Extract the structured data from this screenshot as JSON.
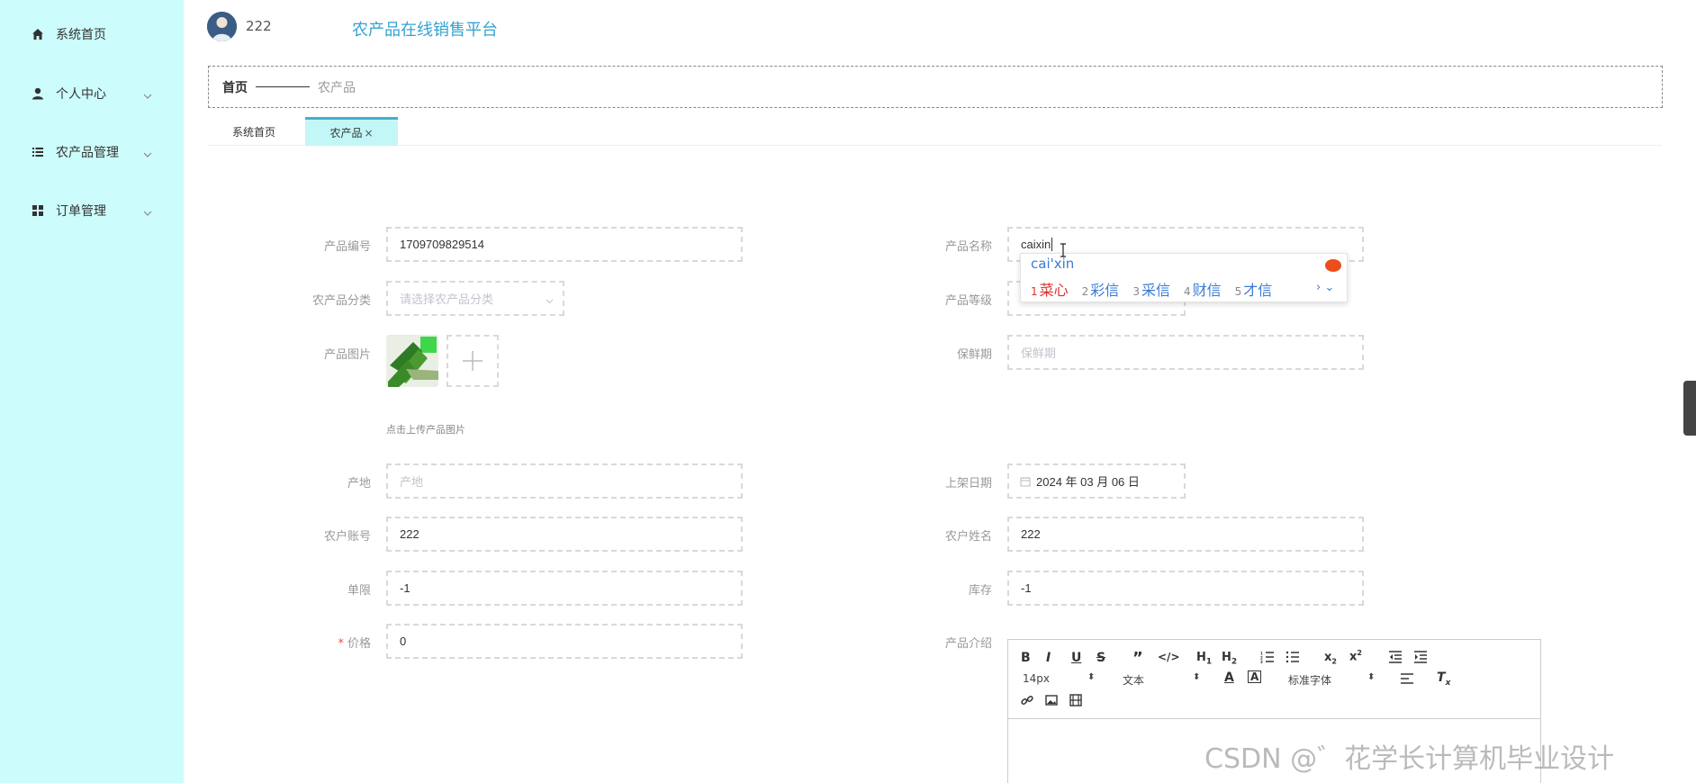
{
  "sidebar": {
    "items": [
      {
        "label": "系统首页",
        "icon": "home-icon"
      },
      {
        "label": "个人中心",
        "icon": "user-icon"
      },
      {
        "label": "农产品管理",
        "icon": "list-icon"
      },
      {
        "label": "订单管理",
        "icon": "grid-icon"
      }
    ]
  },
  "header": {
    "username": "222",
    "platform_title": "农产品在线销售平台"
  },
  "breadcrumb": {
    "home": "首页",
    "current": "农产品"
  },
  "tabs": [
    {
      "label": "系统首页",
      "active": false
    },
    {
      "label": "农产品",
      "active": true,
      "close": "×"
    }
  ],
  "form": {
    "product_code": {
      "label": "产品编号",
      "value": "1709709829514"
    },
    "product_name": {
      "label": "产品名称",
      "value": "caixin"
    },
    "category": {
      "label": "农产品分类",
      "placeholder": "请选择农产品分类"
    },
    "grade": {
      "label": "产品等级"
    },
    "image": {
      "label": "产品图片",
      "hint": "点击上传产品图片"
    },
    "shelf_life": {
      "label": "保鲜期",
      "placeholder": "保鲜期"
    },
    "origin": {
      "label": "产地",
      "placeholder": "产地"
    },
    "listing_date": {
      "label": "上架日期",
      "value": "2024 年 03 月 06 日"
    },
    "farmer_account": {
      "label": "农户账号",
      "value": "222"
    },
    "farmer_name": {
      "label": "农户姓名",
      "value": "222"
    },
    "limit": {
      "label": "单限",
      "value": "-1"
    },
    "stock": {
      "label": "库存",
      "value": "-1"
    },
    "price": {
      "label": "价格",
      "required_mark": "*",
      "value": "0"
    },
    "intro": {
      "label": "产品介绍"
    }
  },
  "ime": {
    "composition": "cai'xin",
    "candidates": [
      {
        "num": "1",
        "text": "菜心"
      },
      {
        "num": "2",
        "text": "彩信"
      },
      {
        "num": "3",
        "text": "采信"
      },
      {
        "num": "4",
        "text": "财信"
      },
      {
        "num": "5",
        "text": "才信"
      }
    ],
    "more": "› ⌄"
  },
  "editor": {
    "font_size": "14px",
    "block": "文本",
    "font_family": "标准字体"
  },
  "watermark": "CSDN @゛花学长计算机毕业设计",
  "colors": {
    "sidebar_bg": "#ccfcfb",
    "accent": "#34a3d1",
    "active_tab_bg": "#c3f7f7",
    "required": "#e85151"
  }
}
